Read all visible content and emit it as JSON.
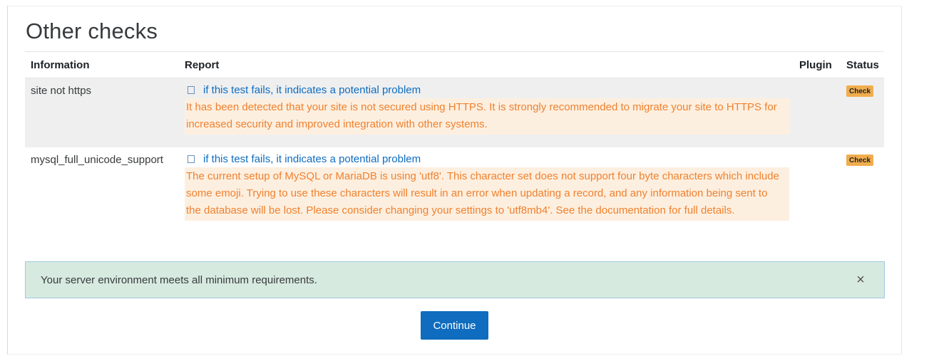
{
  "section": {
    "title": "Other checks"
  },
  "table": {
    "headers": {
      "information": "Information",
      "report": "Report",
      "plugin": "Plugin",
      "status": "Status"
    },
    "rows": [
      {
        "information": "site not https",
        "link_text": "if this test fails, it indicates a potential problem",
        "warning": "It has been detected that your site is not secured using HTTPS. It is strongly recommended to migrate your site to HTTPS for increased security and improved integration with other systems.",
        "plugin": "",
        "status": "Check"
      },
      {
        "information": "mysql_full_unicode_support",
        "link_text": "if this test fails, it indicates a potential problem",
        "warning": "The current setup of MySQL or MariaDB is using 'utf8'. This character set does not support four byte characters which include some emoji. Trying to use these characters will result in an error when updating a record, and any information being sent to the database will be lost. Please consider changing your settings to 'utf8mb4'. See the documentation for full details.",
        "plugin": "",
        "status": "Check"
      }
    ]
  },
  "alert": {
    "message": "Your server environment meets all minimum requirements.",
    "close_symbol": "×"
  },
  "actions": {
    "continue_label": "Continue"
  },
  "colors": {
    "primary": "#0f6cbf",
    "warning_text": "#f0812f",
    "warning_bg": "#fdefdf",
    "badge_warning": "#f0ad4e",
    "success_bg": "#d7eadf"
  },
  "icons": {
    "doc_link": "square-outline-icon",
    "close": "close-icon"
  }
}
